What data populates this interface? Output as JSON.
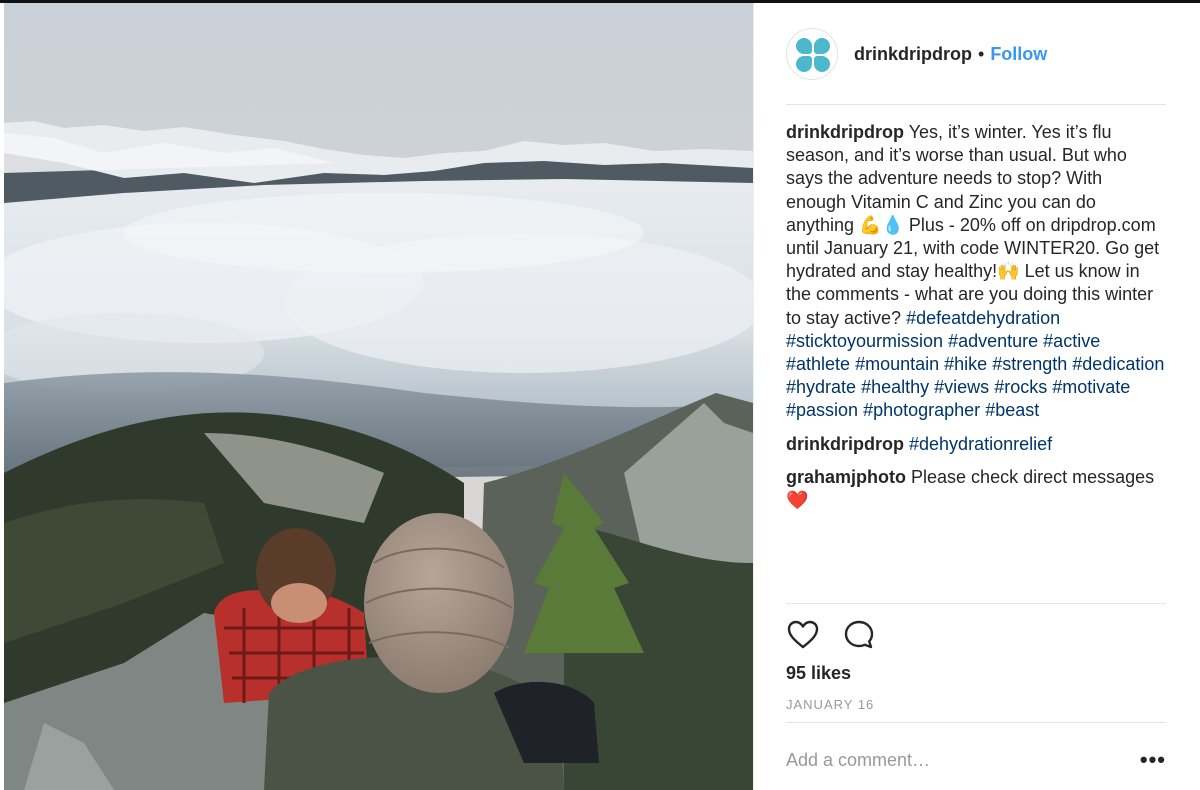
{
  "post": {
    "username": "drinkdripdrop",
    "follow_label": "Follow",
    "dot": "•",
    "caption": {
      "user": "drinkdripdrop",
      "text_1": "Yes, it’s winter. Yes it’s flu season, and it’s worse than usual. But who says the adventure needs to stop? With enough Vitamin C and Zinc you can do anything ",
      "emoji_1": "💪💧",
      "text_2": " Plus - 20% off on dripdrop.com until January 21, with code WINTER20. Go get hydrated and stay healthy!",
      "emoji_2": "🙌",
      "text_3": " Let us know in the comments - what are you doing this winter to stay active? ",
      "hashtags": [
        "#defeatdehydration",
        "#sticktoyourmission",
        "#adventure",
        "#active",
        "#athlete",
        "#mountain",
        "#hike",
        "#strength",
        "#dedication",
        "#hydrate",
        "#healthy",
        "#views",
        "#rocks",
        "#motivate",
        "#passion",
        "#photographer",
        "#beast"
      ]
    },
    "comments": [
      {
        "user": "drinkdripdrop",
        "text": "",
        "hashtag": "#dehydrationrelief"
      },
      {
        "user": "grahamjphoto",
        "text": "Please check direct messages ",
        "emoji": "❤️"
      }
    ],
    "likes": "95 likes",
    "date": "JANUARY 16",
    "add_comment_placeholder": "Add a comment…",
    "more_label": "•••"
  },
  "icons": {
    "like": "heart-icon",
    "comment": "comment-bubble-icon",
    "avatar": "dripdrop-logo"
  },
  "colors": {
    "follow": "#3897f0",
    "hashtag": "#003569",
    "avatar_logo": "#4cb8cd"
  }
}
